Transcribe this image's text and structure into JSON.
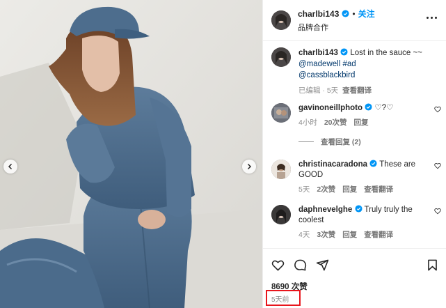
{
  "photo": {
    "prev_icon": "chevron-left-icon",
    "next_icon": "chevron-right-icon"
  },
  "header": {
    "username": "charlbi143",
    "separator": "•",
    "follow_label": "关注",
    "subtitle": "品牌合作",
    "more_icon": "more-horizontal-icon"
  },
  "caption": {
    "username": "charlbi143",
    "text": "Lost in the sauce ~~",
    "tags": [
      "@madewell",
      "#ad",
      "@cassblackbird"
    ],
    "meta_edited": "已编辑 · 5天",
    "translate_label": "查看翻译"
  },
  "comments": [
    {
      "username": "gavinoneillphoto",
      "text": "♡?♡",
      "time": "4小时",
      "likes": "20次赞",
      "reply": "回复",
      "translate": ""
    },
    {
      "username": "christinacaradona",
      "text": "These are GOOD",
      "time": "5天",
      "likes": "2次赞",
      "reply": "回复",
      "translate": "查看翻译"
    },
    {
      "username": "daphnevelghe",
      "text": "Truly truly the coolest",
      "time": "4天",
      "likes": "3次赞",
      "reply": "回复",
      "translate": "查看翻译"
    }
  ],
  "view_replies_label": "查看回复 (2)",
  "actions": {
    "like_icon": "heart-icon",
    "comment_icon": "comment-icon",
    "share_icon": "share-icon",
    "save_icon": "bookmark-icon",
    "likes_count": "8690 次赞",
    "posted_time": "5天前"
  },
  "colors": {
    "accent_blue": "#0095f6",
    "verified_blue": "#0095f6",
    "highlight_red": "#e8151c",
    "denim": "#4f6f8f"
  }
}
